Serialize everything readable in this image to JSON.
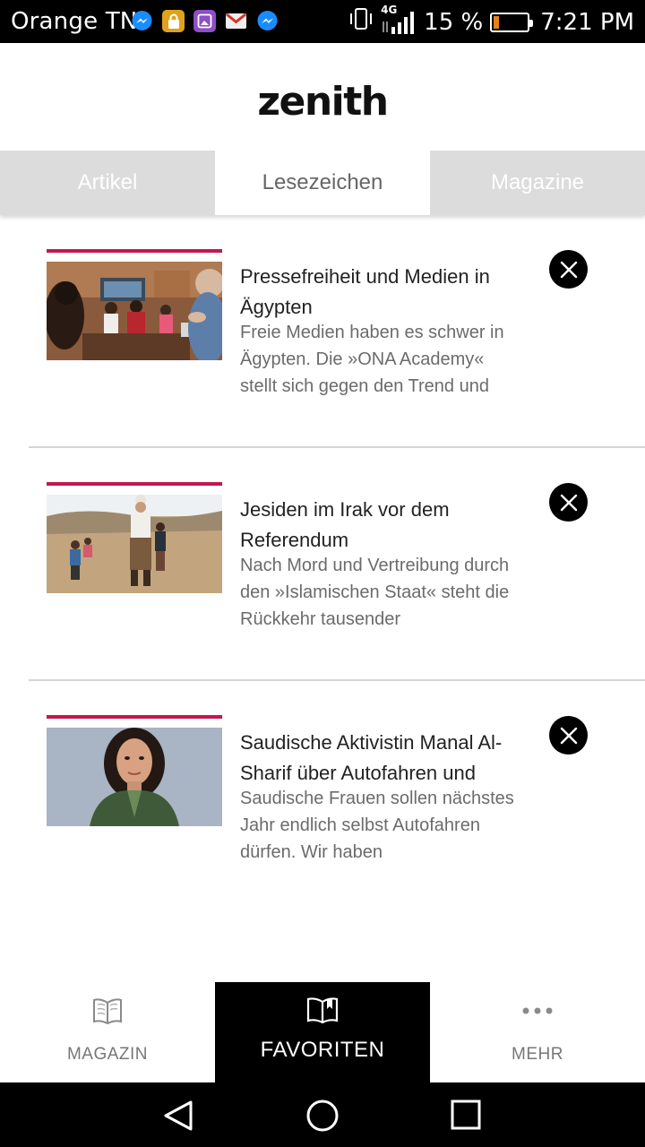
{
  "status_bar": {
    "carrier": "Orange TN",
    "network": "4G",
    "battery_text": "15 %",
    "battery_level": 0.15,
    "time": "7:21 PM",
    "notification_icons": [
      "messenger-icon",
      "lock-app-icon",
      "gallery-icon",
      "gmail-icon",
      "messenger-icon"
    ],
    "battery_color": "#e8801a"
  },
  "header": {
    "logo": "zenith"
  },
  "tabs": [
    {
      "label": "Artikel",
      "active": false
    },
    {
      "label": "Lesezeichen",
      "active": true
    },
    {
      "label": "Magazine",
      "active": false
    }
  ],
  "bookmarks": [
    {
      "title": "Pressefreiheit und Medien in Ägypten",
      "teaser": "Freie Medien haben es schwer in Ägypten. Die »ONA Academy« stellt sich gegen den Trend und",
      "image": "newsroom-photo"
    },
    {
      "title": "Jesiden im Irak vor dem Referendum",
      "teaser": "Nach Mord und Vertreibung durch den »Islamischen Staat« steht die Rückkehr tausender",
      "image": "desert-family-photo"
    },
    {
      "title": "Saudische Aktivistin Manal Al-Sharif über Autofahren und",
      "teaser": "Saudische Frauen sollen nächstes Jahr endlich selbst Autofahren dürfen. Wir haben",
      "image": "portrait-photo"
    }
  ],
  "bottom_nav": [
    {
      "label": "MAGAZIN",
      "icon": "book-icon",
      "active": false
    },
    {
      "label": "FAVORITEN",
      "icon": "bookmark-book-icon",
      "active": true
    },
    {
      "label": "MEHR",
      "icon": "more-icon",
      "active": false
    }
  ],
  "colors": {
    "accent": "#c2184e",
    "tab_bg": "#dcdcdc",
    "active_nav": "#000000"
  }
}
